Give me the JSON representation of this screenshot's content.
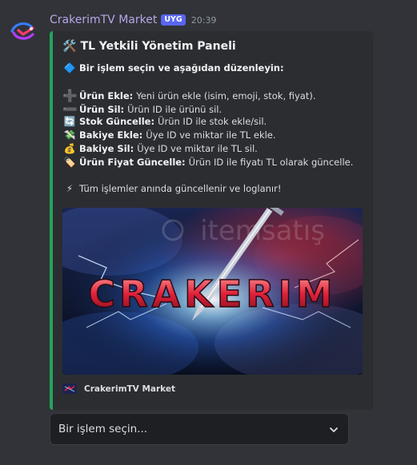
{
  "message": {
    "author": "CrakerimTV Market",
    "badge": "UYG",
    "timestamp": "20:39"
  },
  "embed": {
    "accent_color": "#23a55a",
    "title_icon": "hammer-wrench-icon",
    "title": "TL Yetkili Yönetim Paneli",
    "intro_icon": "blue-diamond-icon",
    "intro": "Bir işlem seçin ve aşağıdan düzenleyin:",
    "items": [
      {
        "icon": "plus-icon",
        "label": "Ürün Ekle:",
        "desc": "Yeni ürün ekle (isim, emoji, stok, fiyat)."
      },
      {
        "icon": "minus-icon",
        "label": "Ürün Sil:",
        "desc": "Ürün ID ile ürünü sil."
      },
      {
        "icon": "refresh-icon",
        "label": "Stok Güncelle:",
        "desc": "Ürün ID ile stok ekle/sil."
      },
      {
        "icon": "money-wings-icon",
        "label": "Bakiye Ekle:",
        "desc": "Üye ID ve miktar ile TL ekle."
      },
      {
        "icon": "money-bag-icon",
        "label": "Bakiye Sil:",
        "desc": "Üye ID ve miktar ile TL sil."
      },
      {
        "icon": "label-tag-icon",
        "label": "Ürün Fiyat Güncelle:",
        "desc": "Ürün ID ile fiyatı TL olarak güncelle."
      }
    ],
    "note_icon": "lightning-icon",
    "note": "Tüm işlemler anında güncellenir ve loglanır!",
    "image": {
      "banner_text": "CRAKERIM",
      "watermark": "itemsatış"
    },
    "footer": {
      "text": "CrakerimTV Market"
    }
  },
  "select": {
    "placeholder": "Bir işlem seçin..."
  }
}
